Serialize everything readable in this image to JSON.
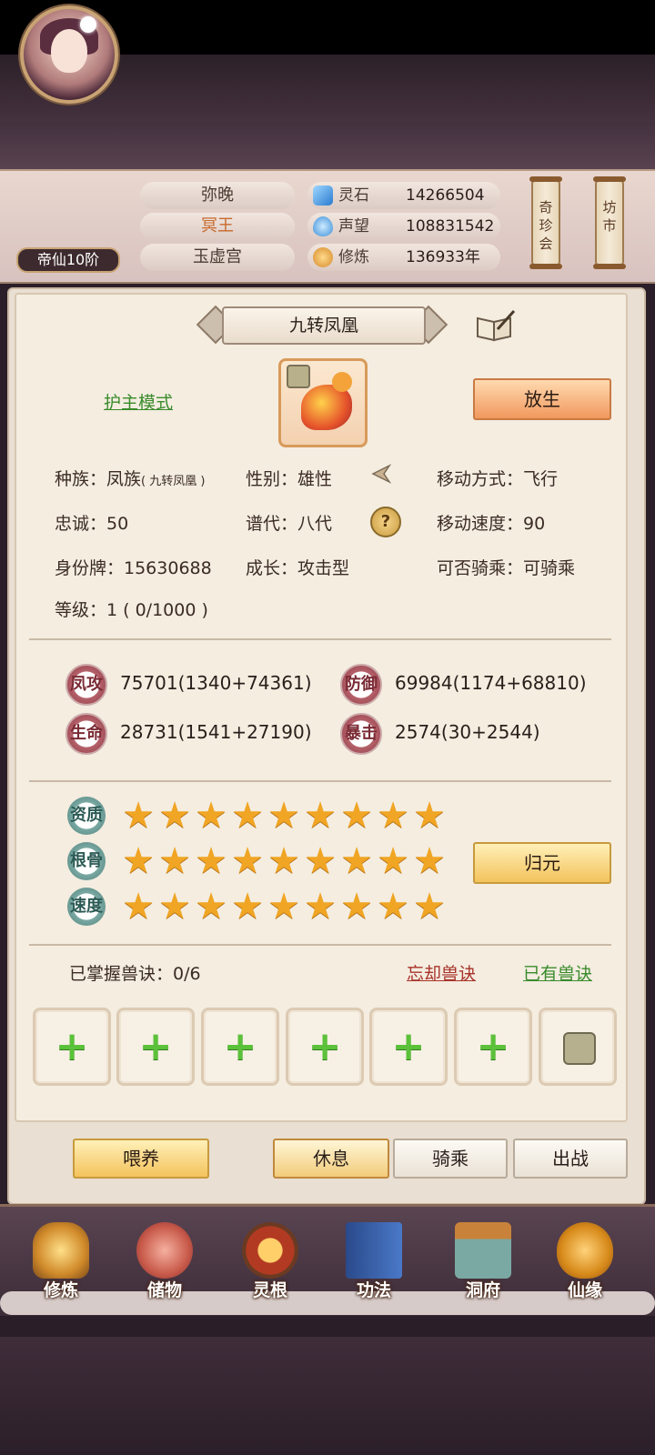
{
  "header": {
    "rank": "帝仙10阶",
    "name": "弥晚",
    "title": "冥王",
    "sect": "玉虚宫",
    "resources": [
      {
        "icon": "spirit-stone-icon",
        "label": "灵石",
        "value": "14266504"
      },
      {
        "icon": "reputation-icon",
        "label": "声望",
        "value": "108831542"
      },
      {
        "icon": "cultivation-icon",
        "label": "修炼",
        "value": "136933年"
      }
    ],
    "scroll_right_1": "奇珍会",
    "scroll_right_2": "坊市"
  },
  "pet": {
    "name": "九转凤凰",
    "mode_link": "护主模式",
    "release_button": "放生",
    "info": {
      "race": "种族：凤族",
      "race_sub": "( 九转凤凰 )",
      "gender": "性别：雄性",
      "move_type": "移动方式：飞行",
      "loyalty": "忠诚：50",
      "generation": "谱代：八代",
      "move_speed": "移动速度：90",
      "id_tag": "身份牌：15630688",
      "growth": "成长：攻击型",
      "rideable": "可否骑乘：可骑乘",
      "level": "等级：1 ( 0/1000 )"
    },
    "stats": [
      {
        "label": "凤攻",
        "value": "75701(1340+74361)"
      },
      {
        "label": "防御",
        "value": "69984(1174+68810)"
      },
      {
        "label": "生命",
        "value": "28731(1541+27190)"
      },
      {
        "label": "暴击",
        "value": "2574(30+2544)"
      }
    ],
    "qualities": [
      {
        "label": "资质",
        "stars": 9
      },
      {
        "label": "根骨",
        "stars": 9
      },
      {
        "label": "速度",
        "stars": 9
      }
    ],
    "reset_button": "归元",
    "skills": {
      "mastered": "已掌握兽诀：0/6",
      "forget_link": "忘却兽诀",
      "owned_link": "已有兽诀",
      "slots": 6
    }
  },
  "actions": {
    "feed": "喂养",
    "rest": "休息",
    "ride": "骑乘",
    "battle": "出战"
  },
  "nav": [
    {
      "label": "修炼",
      "icon": "cultivate-icon"
    },
    {
      "label": "储物",
      "icon": "storage-bag-icon"
    },
    {
      "label": "灵根",
      "icon": "spirit-root-icon"
    },
    {
      "label": "功法",
      "icon": "technique-book-icon"
    },
    {
      "label": "洞府",
      "icon": "cave-dwelling-icon"
    },
    {
      "label": "仙缘",
      "icon": "fortune-gourd-icon"
    }
  ],
  "colors": {
    "accent_orange": "#f1995d",
    "accent_gold": "#f3c35c",
    "link_green": "#3a8b2c",
    "link_red": "#a8322a",
    "plus_green": "#5cc13a"
  }
}
